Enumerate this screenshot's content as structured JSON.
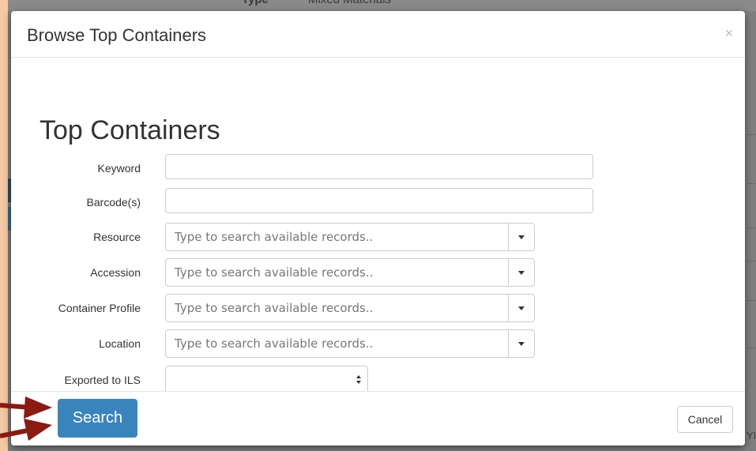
{
  "background": {
    "field_label": "Type",
    "field_value": "Mixed Materials",
    "right_edge_text": "YI"
  },
  "modal": {
    "title": "Browse Top Containers",
    "close_symbol": "×",
    "heading": "Top Containers",
    "fields": {
      "keyword": {
        "label": "Keyword",
        "value": ""
      },
      "barcodes": {
        "label": "Barcode(s)",
        "value": ""
      },
      "resource": {
        "label": "Resource",
        "placeholder": "Type to search available records.."
      },
      "accession": {
        "label": "Accession",
        "placeholder": "Type to search available records.."
      },
      "container_profile": {
        "label": "Container Profile",
        "placeholder": "Type to search available records.."
      },
      "location": {
        "label": "Location",
        "placeholder": "Type to search available records.."
      },
      "exported_to_ils": {
        "label": "Exported to ILS",
        "value": ""
      }
    },
    "footer": {
      "search_label": "Search",
      "cancel_label": "Cancel"
    }
  },
  "colors": {
    "frame": "#f4c9a4",
    "primary_button": "#3a84be",
    "annotation_arrow": "#8b1a10"
  }
}
